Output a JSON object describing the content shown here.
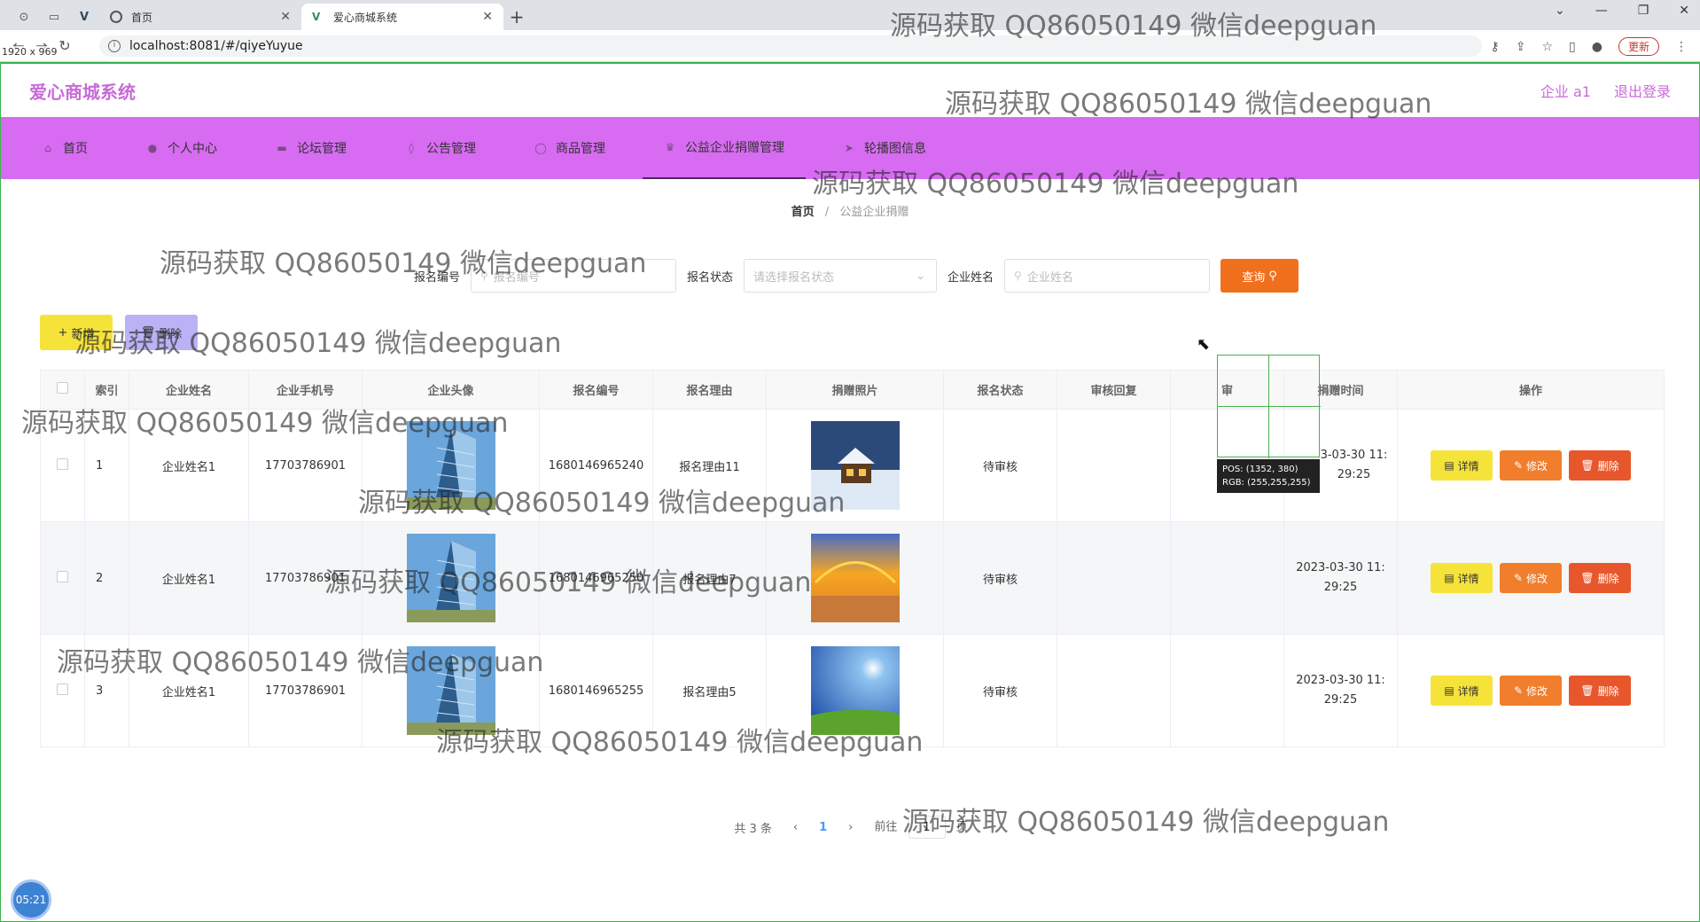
{
  "browser": {
    "tabs": [
      {
        "title": "首页",
        "active": false
      },
      {
        "title": "爱心商城系统",
        "active": true
      }
    ],
    "url": "localhost:8081/#/qiyeYuyue",
    "update_label": "更新",
    "dimension_label": "1920 x 969"
  },
  "header": {
    "logo": "爱心商城系统",
    "user": "企业 a1",
    "logout": "退出登录"
  },
  "nav": {
    "items": [
      {
        "label": "首页",
        "icon": "home-icon"
      },
      {
        "label": "个人中心",
        "icon": "user-icon"
      },
      {
        "label": "论坛管理",
        "icon": "forum-icon"
      },
      {
        "label": "公告管理",
        "icon": "notice-icon"
      },
      {
        "label": "商品管理",
        "icon": "goods-icon"
      },
      {
        "label": "公益企业捐赠管理",
        "icon": "trophy-icon"
      },
      {
        "label": "轮播图信息",
        "icon": "send-icon"
      }
    ],
    "active_index": 5
  },
  "breadcrumb": {
    "home": "首页",
    "current": "公益企业捐赠"
  },
  "search": {
    "fields": [
      {
        "label": "报名编号",
        "placeholder": "报名编号"
      },
      {
        "label": "报名状态",
        "placeholder": "请选择报名状态"
      },
      {
        "label": "企业姓名",
        "placeholder": "企业姓名"
      }
    ],
    "query_label": "查询"
  },
  "actions": {
    "add_label": "新增",
    "delete_label": "删除"
  },
  "table": {
    "columns": [
      "索引",
      "企业姓名",
      "企业手机号",
      "企业头像",
      "报名编号",
      "报名理由",
      "捐赠照片",
      "报名状态",
      "审核回复",
      "审",
      "捐赠时间",
      "操作"
    ],
    "rows": [
      {
        "index": "1",
        "name": "企业姓名1",
        "phone": "17703786901",
        "number": "1680146965240",
        "reason": "报名理由11",
        "status": "待审核",
        "reply": "",
        "time": "2023-03-30 11:29:25",
        "time_line1": "3-03-30 11:",
        "time_line2": "29:25",
        "photo": "snow-house"
      },
      {
        "index": "2",
        "name": "企业姓名1",
        "phone": "17703786901",
        "number": "1680146965250",
        "reason": "报名理由7",
        "status": "待审核",
        "reply": "",
        "time": "2023-03-30 11:29:25",
        "time_line1": "2023-03-30 11:",
        "time_line2": "29:25",
        "photo": "sunset-beach"
      },
      {
        "index": "3",
        "name": "企业姓名1",
        "phone": "17703786901",
        "number": "1680146965255",
        "reason": "报名理由5",
        "status": "待审核",
        "reply": "",
        "time": "2023-03-30 11:29:25",
        "time_line1": "2023-03-30 11:",
        "time_line2": "29:25",
        "photo": "sky-field"
      }
    ],
    "op_labels": {
      "detail": "详情",
      "edit": "修改",
      "delete": "删除"
    }
  },
  "pagination": {
    "total": "共 3 条",
    "current": "1",
    "goto_prefix": "前往",
    "goto_value": "1",
    "goto_suffix": "页"
  },
  "overlay": {
    "pos": "POS: (1352, 380)",
    "rgb": "RGB: (255,255,255)"
  },
  "timer": "05:21",
  "watermark": "源码获取 QQ86050149 微信deepguan",
  "colors": {
    "nav_bg": "#d76bf2",
    "logo": "#c86bd8",
    "query_btn": "#f0701e",
    "add_btn": "#f6e33a",
    "delete_btn": "#b9b2f4"
  }
}
